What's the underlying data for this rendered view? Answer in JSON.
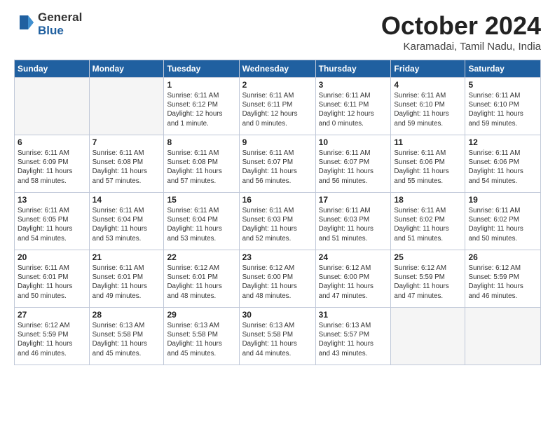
{
  "header": {
    "logo_general": "General",
    "logo_blue": "Blue",
    "month_title": "October 2024",
    "location": "Karamadai, Tamil Nadu, India"
  },
  "days_of_week": [
    "Sunday",
    "Monday",
    "Tuesday",
    "Wednesday",
    "Thursday",
    "Friday",
    "Saturday"
  ],
  "weeks": [
    [
      {
        "day": "",
        "empty": true
      },
      {
        "day": "",
        "empty": true
      },
      {
        "day": "1",
        "line1": "Sunrise: 6:11 AM",
        "line2": "Sunset: 6:12 PM",
        "line3": "Daylight: 12 hours",
        "line4": "and 1 minute."
      },
      {
        "day": "2",
        "line1": "Sunrise: 6:11 AM",
        "line2": "Sunset: 6:11 PM",
        "line3": "Daylight: 12 hours",
        "line4": "and 0 minutes."
      },
      {
        "day": "3",
        "line1": "Sunrise: 6:11 AM",
        "line2": "Sunset: 6:11 PM",
        "line3": "Daylight: 12 hours",
        "line4": "and 0 minutes."
      },
      {
        "day": "4",
        "line1": "Sunrise: 6:11 AM",
        "line2": "Sunset: 6:10 PM",
        "line3": "Daylight: 11 hours",
        "line4": "and 59 minutes."
      },
      {
        "day": "5",
        "line1": "Sunrise: 6:11 AM",
        "line2": "Sunset: 6:10 PM",
        "line3": "Daylight: 11 hours",
        "line4": "and 59 minutes."
      }
    ],
    [
      {
        "day": "6",
        "line1": "Sunrise: 6:11 AM",
        "line2": "Sunset: 6:09 PM",
        "line3": "Daylight: 11 hours",
        "line4": "and 58 minutes."
      },
      {
        "day": "7",
        "line1": "Sunrise: 6:11 AM",
        "line2": "Sunset: 6:08 PM",
        "line3": "Daylight: 11 hours",
        "line4": "and 57 minutes."
      },
      {
        "day": "8",
        "line1": "Sunrise: 6:11 AM",
        "line2": "Sunset: 6:08 PM",
        "line3": "Daylight: 11 hours",
        "line4": "and 57 minutes."
      },
      {
        "day": "9",
        "line1": "Sunrise: 6:11 AM",
        "line2": "Sunset: 6:07 PM",
        "line3": "Daylight: 11 hours",
        "line4": "and 56 minutes."
      },
      {
        "day": "10",
        "line1": "Sunrise: 6:11 AM",
        "line2": "Sunset: 6:07 PM",
        "line3": "Daylight: 11 hours",
        "line4": "and 56 minutes."
      },
      {
        "day": "11",
        "line1": "Sunrise: 6:11 AM",
        "line2": "Sunset: 6:06 PM",
        "line3": "Daylight: 11 hours",
        "line4": "and 55 minutes."
      },
      {
        "day": "12",
        "line1": "Sunrise: 6:11 AM",
        "line2": "Sunset: 6:06 PM",
        "line3": "Daylight: 11 hours",
        "line4": "and 54 minutes."
      }
    ],
    [
      {
        "day": "13",
        "line1": "Sunrise: 6:11 AM",
        "line2": "Sunset: 6:05 PM",
        "line3": "Daylight: 11 hours",
        "line4": "and 54 minutes."
      },
      {
        "day": "14",
        "line1": "Sunrise: 6:11 AM",
        "line2": "Sunset: 6:04 PM",
        "line3": "Daylight: 11 hours",
        "line4": "and 53 minutes."
      },
      {
        "day": "15",
        "line1": "Sunrise: 6:11 AM",
        "line2": "Sunset: 6:04 PM",
        "line3": "Daylight: 11 hours",
        "line4": "and 53 minutes."
      },
      {
        "day": "16",
        "line1": "Sunrise: 6:11 AM",
        "line2": "Sunset: 6:03 PM",
        "line3": "Daylight: 11 hours",
        "line4": "and 52 minutes."
      },
      {
        "day": "17",
        "line1": "Sunrise: 6:11 AM",
        "line2": "Sunset: 6:03 PM",
        "line3": "Daylight: 11 hours",
        "line4": "and 51 minutes."
      },
      {
        "day": "18",
        "line1": "Sunrise: 6:11 AM",
        "line2": "Sunset: 6:02 PM",
        "line3": "Daylight: 11 hours",
        "line4": "and 51 minutes."
      },
      {
        "day": "19",
        "line1": "Sunrise: 6:11 AM",
        "line2": "Sunset: 6:02 PM",
        "line3": "Daylight: 11 hours",
        "line4": "and 50 minutes."
      }
    ],
    [
      {
        "day": "20",
        "line1": "Sunrise: 6:11 AM",
        "line2": "Sunset: 6:01 PM",
        "line3": "Daylight: 11 hours",
        "line4": "and 50 minutes."
      },
      {
        "day": "21",
        "line1": "Sunrise: 6:11 AM",
        "line2": "Sunset: 6:01 PM",
        "line3": "Daylight: 11 hours",
        "line4": "and 49 minutes."
      },
      {
        "day": "22",
        "line1": "Sunrise: 6:12 AM",
        "line2": "Sunset: 6:01 PM",
        "line3": "Daylight: 11 hours",
        "line4": "and 48 minutes."
      },
      {
        "day": "23",
        "line1": "Sunrise: 6:12 AM",
        "line2": "Sunset: 6:00 PM",
        "line3": "Daylight: 11 hours",
        "line4": "and 48 minutes."
      },
      {
        "day": "24",
        "line1": "Sunrise: 6:12 AM",
        "line2": "Sunset: 6:00 PM",
        "line3": "Daylight: 11 hours",
        "line4": "and 47 minutes."
      },
      {
        "day": "25",
        "line1": "Sunrise: 6:12 AM",
        "line2": "Sunset: 5:59 PM",
        "line3": "Daylight: 11 hours",
        "line4": "and 47 minutes."
      },
      {
        "day": "26",
        "line1": "Sunrise: 6:12 AM",
        "line2": "Sunset: 5:59 PM",
        "line3": "Daylight: 11 hours",
        "line4": "and 46 minutes."
      }
    ],
    [
      {
        "day": "27",
        "line1": "Sunrise: 6:12 AM",
        "line2": "Sunset: 5:59 PM",
        "line3": "Daylight: 11 hours",
        "line4": "and 46 minutes."
      },
      {
        "day": "28",
        "line1": "Sunrise: 6:13 AM",
        "line2": "Sunset: 5:58 PM",
        "line3": "Daylight: 11 hours",
        "line4": "and 45 minutes."
      },
      {
        "day": "29",
        "line1": "Sunrise: 6:13 AM",
        "line2": "Sunset: 5:58 PM",
        "line3": "Daylight: 11 hours",
        "line4": "and 45 minutes."
      },
      {
        "day": "30",
        "line1": "Sunrise: 6:13 AM",
        "line2": "Sunset: 5:58 PM",
        "line3": "Daylight: 11 hours",
        "line4": "and 44 minutes."
      },
      {
        "day": "31",
        "line1": "Sunrise: 6:13 AM",
        "line2": "Sunset: 5:57 PM",
        "line3": "Daylight: 11 hours",
        "line4": "and 43 minutes."
      },
      {
        "day": "",
        "empty": true
      },
      {
        "day": "",
        "empty": true
      }
    ]
  ]
}
